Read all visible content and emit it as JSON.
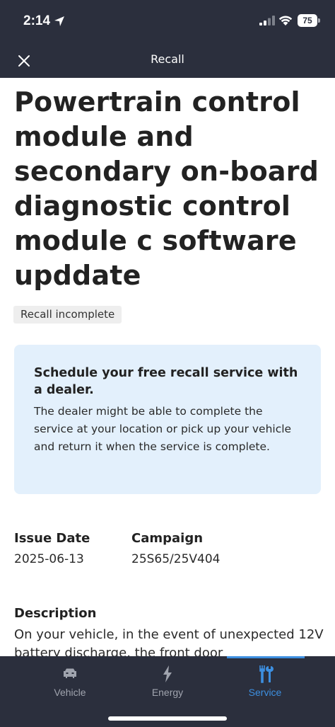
{
  "status_bar": {
    "time": "2:14",
    "battery": "75"
  },
  "header": {
    "title": "Recall"
  },
  "recall": {
    "title": "Powertrain control module and secondary on-board diagnostic control module c software upddate",
    "status": "Recall incomplete"
  },
  "info_card": {
    "title": "Schedule your free recall service with a dealer.",
    "body": "The dealer might be able to complete the service at your location or pick up your vehicle and return it when the service is complete."
  },
  "details": {
    "issue_date_label": "Issue Date",
    "issue_date": "2025-06-13",
    "campaign_label": "Campaign",
    "campaign": "25S65/25V404"
  },
  "description": {
    "heading": "Description",
    "text": "On your vehicle, in the event of unexpected 12V battery discharge, the front door"
  },
  "tabs": [
    {
      "label": "Vehicle",
      "icon": "car-icon",
      "active": false
    },
    {
      "label": "Energy",
      "icon": "lightning-icon",
      "active": false
    },
    {
      "label": "Service",
      "icon": "tools-icon",
      "active": true
    }
  ],
  "colors": {
    "header_bg": "#2b2f3d",
    "accent": "#3d8fe0",
    "card_bg": "#e3f0fc",
    "badge_bg": "#eeeeee"
  }
}
